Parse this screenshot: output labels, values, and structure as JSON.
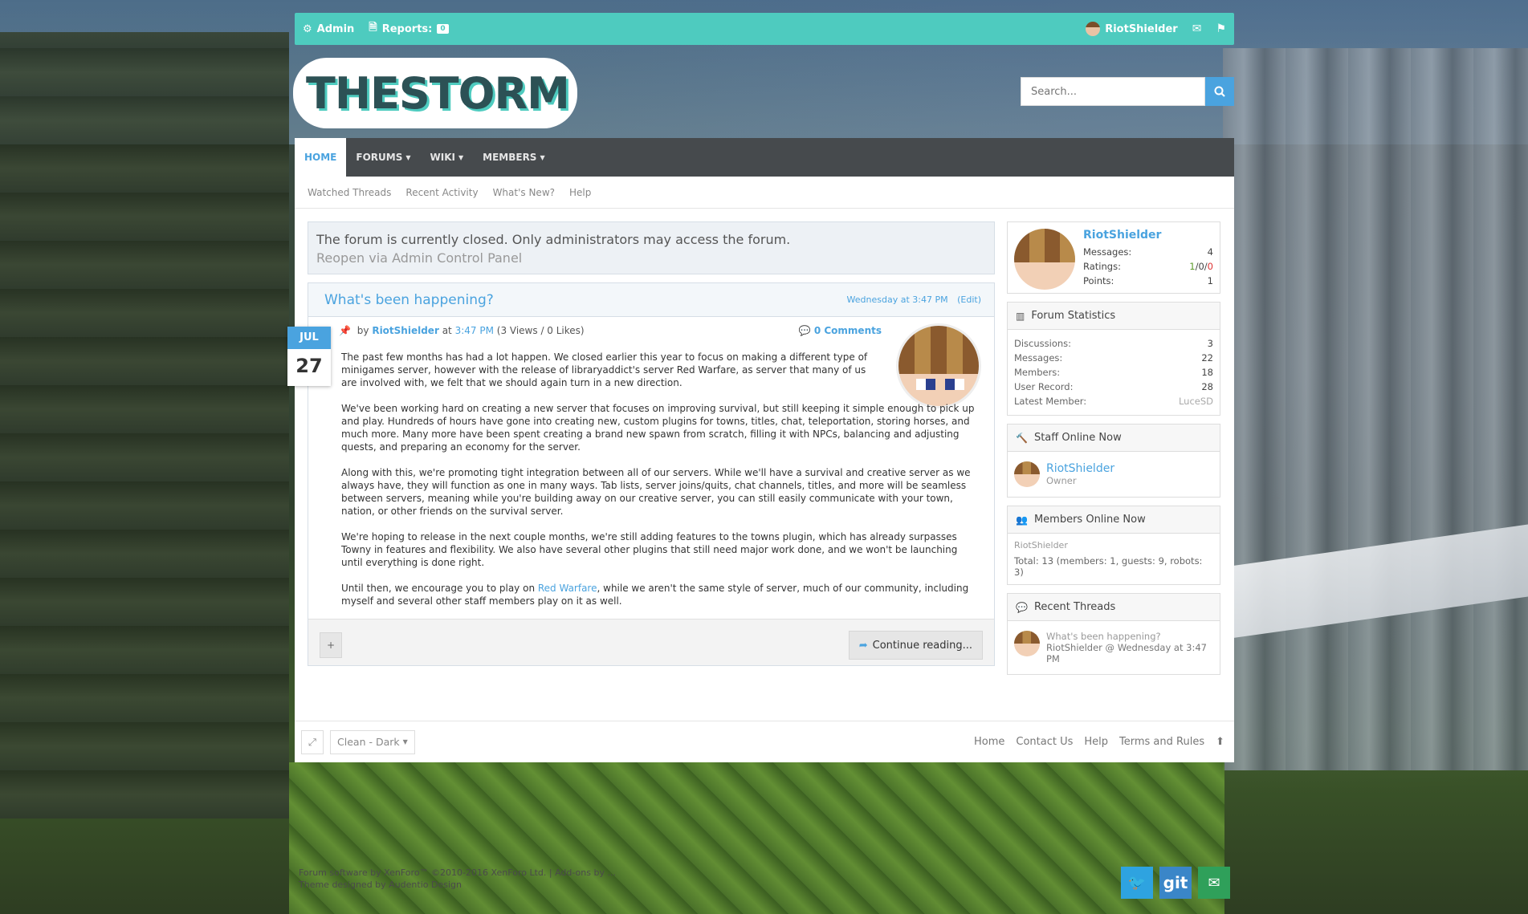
{
  "admin_bar": {
    "admin_label": "Admin",
    "reports_label": "Reports:",
    "reports_count": "0",
    "username": "RiotShielder"
  },
  "header": {
    "logo_text": "THESTORM",
    "search_placeholder": "Search..."
  },
  "nav": {
    "tabs": [
      {
        "label": "HOME",
        "active": true
      },
      {
        "label": "FORUMS"
      },
      {
        "label": "WIKI"
      },
      {
        "label": "MEMBERS"
      }
    ],
    "sub_links": [
      "Watched Threads",
      "Recent Activity",
      "What's New?",
      "Help"
    ]
  },
  "notice": {
    "message": "The forum is currently closed. Only administrators may access the forum.",
    "link": "Reopen via Admin Control Panel"
  },
  "article": {
    "title": "What's been happening?",
    "date_text": "Wednesday at 3:47 PM",
    "edit_label": "(Edit)",
    "month": "JUL",
    "day": "27",
    "by": "by",
    "author": "RiotShielder",
    "at": "at",
    "time": "3:47 PM",
    "stats": "(3 Views / 0 Likes)",
    "comments": "0 Comments",
    "paragraphs": [
      "The past few months has had a lot happen. We closed earlier this year to focus on making a different type of minigames server, however with the release of libraryaddict's server Red Warfare, as server that many of us are involved with, we felt that we should again turn in a new direction.",
      "We've been working hard on creating a new server that focuses on improving survival, but still keeping it simple enough to pick up and play. Hundreds of hours have gone into creating new, custom plugins for towns, titles, chat, teleportation, storing horses, and much more. Many more have been spent creating a brand new spawn from scratch, filling it with NPCs, balancing and adjusting quests, and preparing an economy for the server.",
      "Along with this, we're promoting tight integration between all of our servers. While we'll have a survival and creative server as we always have, they will function as one in many ways. Tab lists, server joins/quits, chat channels, titles, and more will be seamless between servers, meaning while you're building away on our creative server, you can still easily communicate with your town, nation, or other friends on the survival server.",
      "We're hoping to release in the next couple months, we're still adding features to the towns plugin, which has already surpasses Towny in features and flexibility. We also have several other plugins that still need major work done, and we won't be launching until everything is done right."
    ],
    "last_para_start": "Until then, we encourage you to play on ",
    "last_para_link": "Red Warfare",
    "last_para_end": ", while we aren't the same style of server, much of our community, including myself and several other staff members play on it as well.",
    "plus_label": "+",
    "continue_label": "Continue reading..."
  },
  "sidebar": {
    "visitor": {
      "name": "RiotShielder",
      "messages_label": "Messages:",
      "messages": "4",
      "ratings_label": "Ratings:",
      "ratings_pos": "1",
      "ratings_neutral": "0",
      "ratings_neg": "0",
      "points_label": "Points:",
      "points": "1"
    },
    "stats": {
      "title": "Forum Statistics",
      "rows": [
        {
          "label": "Discussions:",
          "value": "3"
        },
        {
          "label": "Messages:",
          "value": "22"
        },
        {
          "label": "Members:",
          "value": "18"
        },
        {
          "label": "User Record:",
          "value": "28"
        },
        {
          "label": "Latest Member:",
          "value": "LuceSD"
        }
      ]
    },
    "staff": {
      "title": "Staff Online Now",
      "name": "RiotShielder",
      "role": "Owner"
    },
    "members_online": {
      "title": "Members Online Now",
      "name": "RiotShielder",
      "total": "Total: 13 (members: 1, guests: 9, robots: 3)"
    },
    "recent_threads": {
      "title": "Recent Threads",
      "thread_title": "What's been happening?",
      "meta": "RiotShielder @ Wednesday at 3:47 PM"
    }
  },
  "footer": {
    "style_label": "Clean - Dark",
    "links": [
      "Home",
      "Contact Us",
      "Help",
      "Terms and Rules"
    ],
    "copyright_1": "Forum software by XenForo™ ©2010-2016 XenForo Ltd. | Add-ons by ...",
    "copyright_2": "Theme designed by Audentio Design"
  },
  "social": {
    "git_label": "git"
  },
  "colors": {
    "accent": "#4aa3df",
    "admin_bar": "#4ecbbf",
    "nav_bg": "#464a4d"
  }
}
